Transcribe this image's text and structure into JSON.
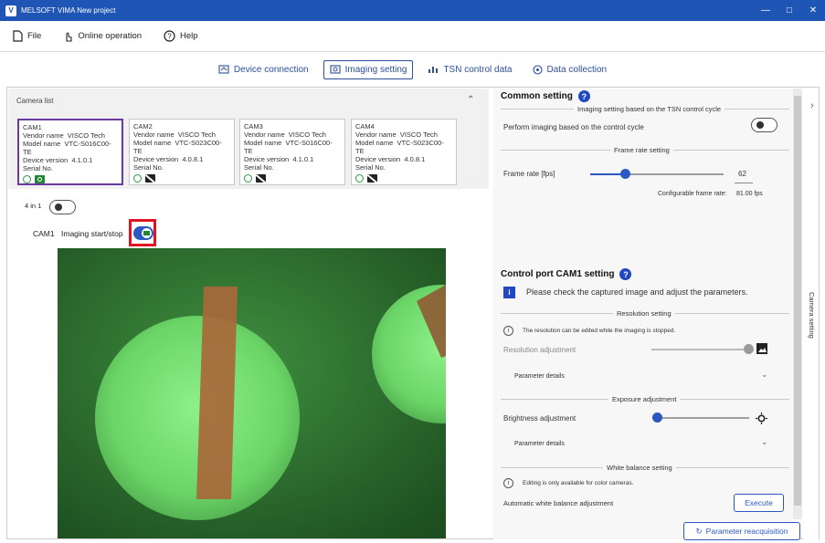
{
  "window": {
    "title": "MELSOFT VIMA New project",
    "app_icon": "V"
  },
  "menu": {
    "file": "File",
    "online": "Online operation",
    "help": "Help"
  },
  "tabs": [
    {
      "label": "Device connection"
    },
    {
      "label": "Imaging setting"
    },
    {
      "label": "TSN control data"
    },
    {
      "label": "Data collection"
    }
  ],
  "camera_list": {
    "header": "Camera list",
    "cameras": [
      {
        "name": "CAM1",
        "vendor_label": "Vendor name",
        "vendor": "VISCO Tech",
        "model_label": "Model name",
        "model": "VTC-S016C00-TE",
        "version_label": "Device version",
        "version": "4.1.0.1",
        "serial_label": "Serial No.",
        "imaging": "on"
      },
      {
        "name": "CAM2",
        "vendor_label": "Vendor name",
        "vendor": "VISCO Tech",
        "model_label": "Model name",
        "model": "VTC-S023C00-TE",
        "version_label": "Device version",
        "version": "4.0.8.1",
        "serial_label": "Serial No.",
        "imaging": "off"
      },
      {
        "name": "CAM3",
        "vendor_label": "Vendor name",
        "vendor": "VISCO Tech",
        "model_label": "Model name",
        "model": "VTC-S016C00-TE",
        "version_label": "Device version",
        "version": "4.1.0.1",
        "serial_label": "Serial No.",
        "imaging": "off"
      },
      {
        "name": "CAM4",
        "vendor_label": "Vendor name",
        "vendor": "VISCO Tech",
        "model_label": "Model name",
        "model": "VTC-S023C00-TE",
        "version_label": "Device version",
        "version": "4.0.8.1",
        "serial_label": "Serial No.",
        "imaging": "off"
      }
    ]
  },
  "view": {
    "four_in_one": "4 in 1",
    "cam_label": "CAM1",
    "imaging_start_stop": "Imaging start/stop"
  },
  "common_setting": {
    "title": "Common setting",
    "tsn_section": "Imaging setting based on the TSN control cycle",
    "perform_imaging": "Perform imaging based on the control cycle",
    "frame_rate_section": "Frame rate setting",
    "frame_rate_label": "Frame rate [fps]",
    "frame_rate_value": "62",
    "configurable_label": "Configurable frame rate:",
    "configurable_value": "81.00 fps"
  },
  "control_port": {
    "title": "Control port CAM1 setting",
    "info": "Please check the captured image and adjust the parameters.",
    "resolution_section": "Resolution setting",
    "resolution_note": "The resolution can be edited while the imaging is stopped.",
    "resolution_adjustment": "Resolution adjustment",
    "parameter_details": "Parameter details",
    "exposure_section": "Exposure adjustment",
    "brightness_adjustment": "Brightness adjustment",
    "parameter_details2": "Parameter details",
    "white_balance_section": "White balance setting",
    "white_balance_note": "Editing is only available for color cameras.",
    "auto_white_balance": "Automatic white balance adjustment",
    "execute": "Execute",
    "reacquisition": "Parameter reacquisition"
  },
  "side_panel": {
    "label": "Camera setting"
  },
  "colors": {
    "accent": "#2c58c3",
    "titlebar": "#1f56b5",
    "highlight": "#e0141e",
    "selected": "#6a3aa0"
  }
}
